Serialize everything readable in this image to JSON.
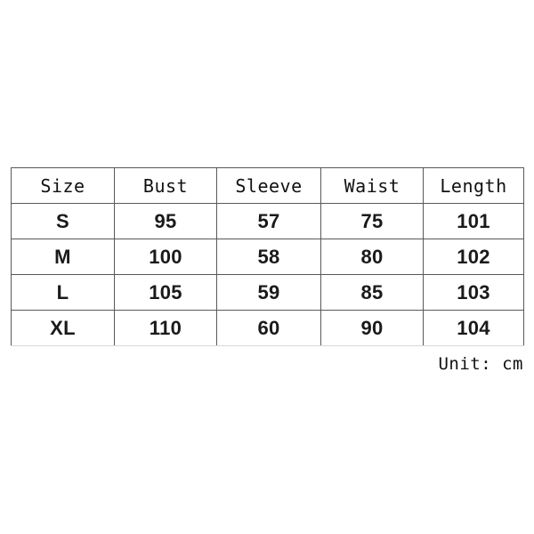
{
  "table": {
    "columns": [
      "Size",
      "Bust",
      "Sleeve",
      "Waist",
      "Length"
    ],
    "rows": [
      {
        "size": "S",
        "bust": "95",
        "sleeve": "57",
        "waist": "75",
        "length": "101"
      },
      {
        "size": "M",
        "bust": "100",
        "sleeve": "58",
        "waist": "80",
        "length": "102"
      },
      {
        "size": "L",
        "bust": "105",
        "sleeve": "59",
        "waist": "85",
        "length": "103"
      },
      {
        "size": "XL",
        "bust": "110",
        "sleeve": "60",
        "waist": "90",
        "length": "104"
      }
    ]
  },
  "unit_note": "Unit: cm",
  "colors": {
    "background": "#ffffff",
    "border": "#595959",
    "header_text": "#111111",
    "data_text": "#1a1a1a"
  }
}
